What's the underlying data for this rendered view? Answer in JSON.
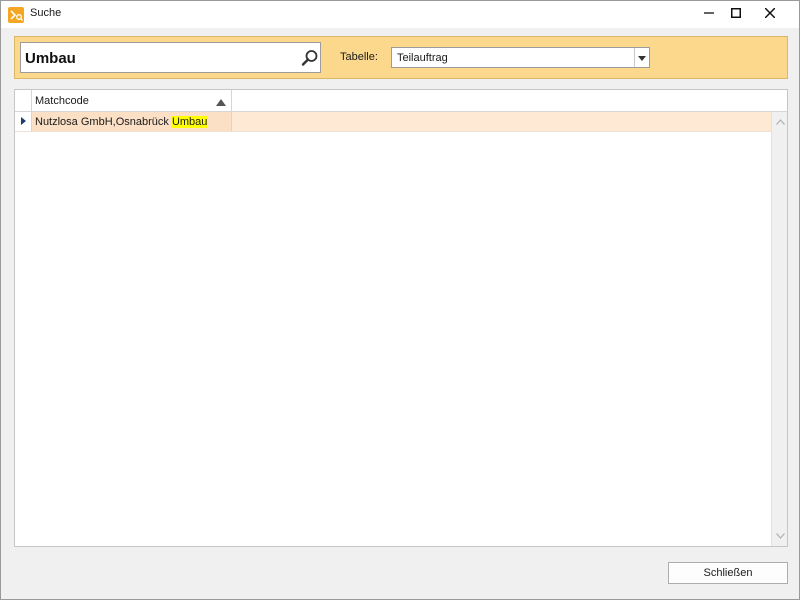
{
  "window": {
    "title": "Suche",
    "icon": "app-search-icon",
    "controls": [
      "minimize-icon",
      "maximize-icon",
      "close-icon"
    ]
  },
  "search": {
    "value": "Umbau",
    "icon": "search-icon"
  },
  "table_selector": {
    "label": "Tabelle:",
    "selected": "Teilauftrag"
  },
  "grid": {
    "columns": [
      {
        "label": "Matchcode",
        "sort": "ascending"
      }
    ],
    "rows": [
      {
        "prefix": "Nutzlosa GmbH,Osnabrück ",
        "match": "Umbau",
        "current": true
      }
    ]
  },
  "footer": {
    "close_label": "Schließen"
  },
  "colors": {
    "accent_panel": "#fbd88c",
    "row_selected": "#fce0c6",
    "highlight": "#ffff00",
    "app_icon": "#f5a623"
  }
}
